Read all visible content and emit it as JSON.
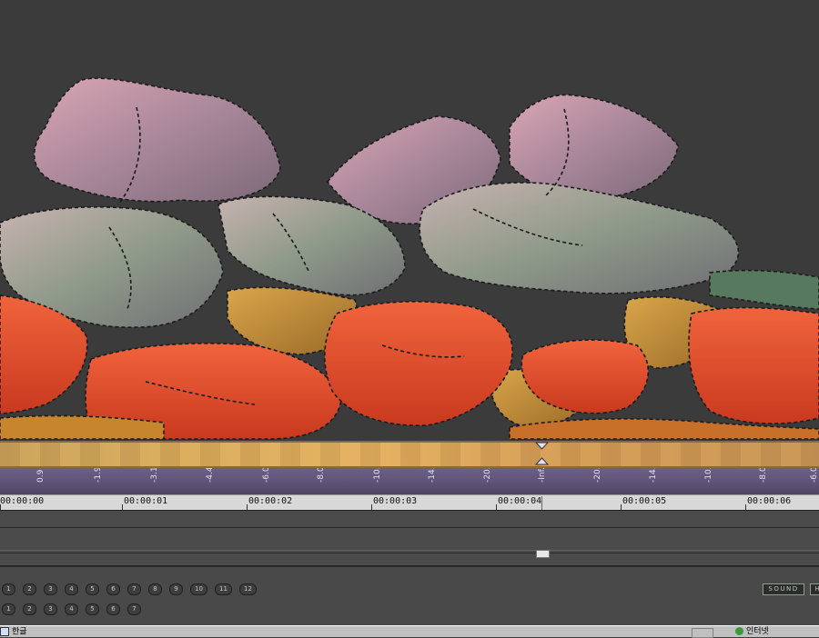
{
  "meter": {
    "labels": [
      "0.9",
      "-1.9",
      "-3.1",
      "-4.4",
      "-6.0",
      "-8.0",
      "-10.5",
      "-14.0",
      "-20.0",
      "-Inf.",
      "-20.0",
      "-14.0",
      "-10.5",
      "-8.0",
      "-6.0"
    ]
  },
  "ruler": {
    "timecodes": [
      "00:00:00",
      "00:00:01",
      "00:00:02",
      "00:00:03",
      "00:00:04",
      "00:00:05",
      "00:00:06"
    ]
  },
  "buttons": {
    "row1": [
      "1",
      "2",
      "3",
      "4",
      "5",
      "6",
      "7",
      "8",
      "9",
      "10",
      "11",
      "12"
    ],
    "row2": [
      "1",
      "2",
      "3",
      "4",
      "5",
      "6",
      "7"
    ],
    "sound": "SOUND",
    "extra": "H"
  },
  "taskbar": {
    "app": "한글",
    "network": "인터넷"
  },
  "colors": {
    "background": "#3b3b3b",
    "meter": "#5f5377",
    "ruler": "#d8d8d8",
    "sound_border": "#8aa08a"
  }
}
